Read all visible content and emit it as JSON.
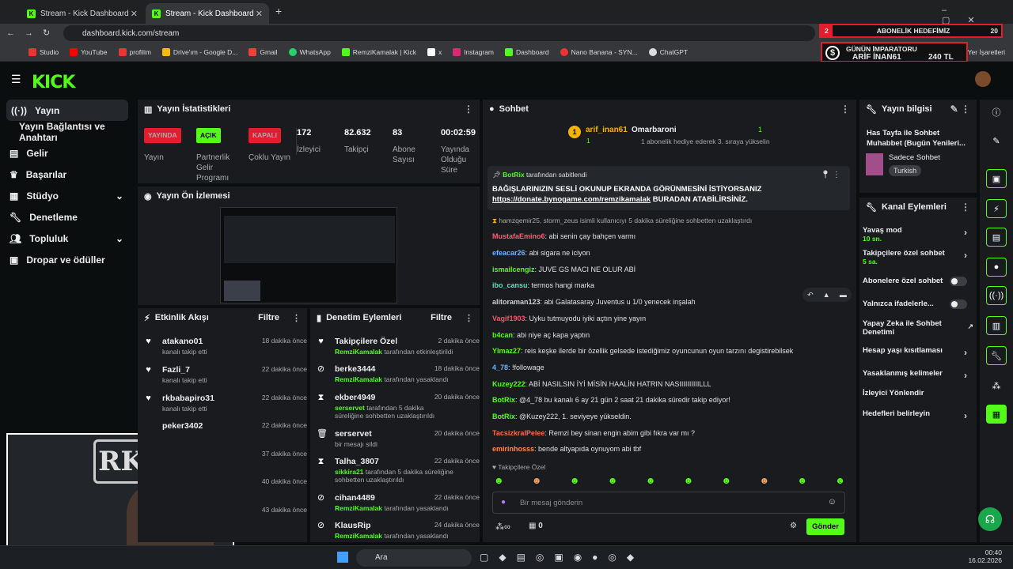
{
  "browser": {
    "tabs": [
      {
        "label": "Stream - Kick Dashboard"
      },
      {
        "label": "Stream - Kick Dashboard"
      }
    ],
    "url": "dashboard.kick.com/stream",
    "bookmarks": [
      "Studio",
      "YouTube",
      "profilim",
      "Drive'ım - Google D...",
      "Gmail",
      "WhatsApp",
      "RemziKamalak | Kick",
      "x",
      "Instagram",
      "Dashboard",
      "Nano Banana - SYN...",
      "ChatGPT"
    ],
    "bookmarks_right": "Yer İşaretleri"
  },
  "overlay": {
    "goal_num": "2",
    "goal_label": "ABONELİK HEDEFİMİZ",
    "goal_max": "20",
    "emperor_title": "GÜNÜN İMPARATORU",
    "emperor_name": "ARİF İNAN61",
    "emperor_amount": "240 TL"
  },
  "sidebar": {
    "items": [
      {
        "label": "Yayın"
      },
      {
        "label": "Yayın Bağlantısı ve Anahtarı"
      },
      {
        "label": "Gelir"
      },
      {
        "label": "Başarılar"
      },
      {
        "label": "Stüdyo"
      },
      {
        "label": "Denetleme"
      },
      {
        "label": "Topluluk"
      },
      {
        "label": "Dropar ve ödüller"
      }
    ]
  },
  "stats": {
    "title": "Yayın İstatistikleri",
    "items": [
      {
        "badge": "YAYINDA",
        "label": "Yayın",
        "color": "#e11d2e"
      },
      {
        "badge": "AÇIK",
        "label": "Partnerlik Gelir Programı",
        "color": "#53fc18"
      },
      {
        "badge": "KAPALI",
        "label": "Çoklu Yayın",
        "color": "#e11d2e"
      },
      {
        "value": "172",
        "label": "İzleyici"
      },
      {
        "value": "82.632",
        "label": "Takipçi"
      },
      {
        "value": "83",
        "label": "Abone Sayısı"
      },
      {
        "value": "00:02:59",
        "label": "Yayında Olduğu Süre"
      }
    ]
  },
  "preview": {
    "title": "Yayın Ön İzlemesi"
  },
  "activity": {
    "title": "Etkinlik Akışı",
    "filter": "Filtre",
    "items": [
      {
        "name": "atakano01",
        "sub": "kanalı takip etti",
        "time": "18 dakika önce"
      },
      {
        "name": "Fazli_7",
        "sub": "kanalı takip etti",
        "time": "22 dakika önce"
      },
      {
        "name": "rkbabapiro31",
        "sub": "kanalı takip etti",
        "time": "22 dakika önce"
      },
      {
        "name": "peker3402",
        "sub": "",
        "time": "22 dakika önce"
      },
      {
        "name": "",
        "sub": "",
        "time": "37 dakika önce"
      },
      {
        "name": "",
        "sub": "",
        "time": "40 dakika önce"
      },
      {
        "name": "",
        "sub": "",
        "time": "43 dakika önce"
      }
    ]
  },
  "moderation": {
    "title": "Denetim Eylemleri",
    "filter": "Filtre",
    "items": [
      {
        "name": "Takipçilere Özel",
        "who": "RemziKamalak",
        "sub": "tarafından etkinleştirildi",
        "time": "2 dakika önce",
        "icon": "heart"
      },
      {
        "name": "berke3444",
        "who": "RemziKamalak",
        "sub": "tarafından yasaklandı",
        "time": "18 dakika önce",
        "icon": "ban"
      },
      {
        "name": "ekber4949",
        "who": "serservet",
        "sub": "tarafından 5 dakika süreliğine sohbetten uzaklaştırıldı",
        "time": "20 dakika önce",
        "icon": "hourglass"
      },
      {
        "name": "serservet",
        "who": "",
        "sub": "bir mesajı sildi",
        "time": "20 dakika önce",
        "icon": "trash"
      },
      {
        "name": "Talha_3807",
        "who": "sikkira21",
        "sub": "tarafından 5 dakika süreliğine sohbetten uzaklaştırıldı",
        "time": "22 dakika önce",
        "icon": "hourglass"
      },
      {
        "name": "cihan4489",
        "who": "RemziKamalak",
        "sub": "tarafından yasaklandı",
        "time": "22 dakika önce",
        "icon": "ban"
      },
      {
        "name": "KlausRip",
        "who": "RemziKamalak",
        "sub": "tarafından yasaklandı",
        "time": "24 dakika önce",
        "icon": "ban"
      }
    ]
  },
  "chat": {
    "title": "Sohbet",
    "gifter_rank": "1",
    "gifter_name": "arif_inan61",
    "gifter_count": "1",
    "next_name": "Omarbaroni",
    "next_rank": "1",
    "next_sub": "1 abonelik hediye ederek 3. sıraya yükselin",
    "pinned_by": "BotRix",
    "pinned_suffix": "tarafından sabitlendi",
    "pinned_text": "BAĞIŞLARINIZIN SESLİ OKUNUP EKRANDA GÖRÜNMESİNİ İSTİYORSANIZ",
    "pinned_link": "https://donate.bynogame.com/remzikamalak",
    "pinned_link_suffix": "BURADAN ATABİLİRSİNİZ.",
    "system": "hamzqemir25, storm_zeus isimli kullanıcıyı 5 dakika süreliğine sohbetten uzaklaştırdı",
    "messages": [
      {
        "user": "MustafaEmino6",
        "text": "abi senin çay bahçen varmı",
        "color": "#ff5c7a"
      },
      {
        "user": "efeacar26",
        "text": "abi sigara ne iciyon",
        "color": "#6fb4ff"
      },
      {
        "user": "ismailcengiz",
        "text": "JUVE GS MACI NE OLUR ABİ",
        "color": "#53fc18"
      },
      {
        "user": "ibo_cansu",
        "text": "termos hangi marka",
        "color": "#4fe3c1"
      },
      {
        "user": "alitoraman123",
        "text": "abi Galatasaray Juventus u 1/0 yenecek inşalah",
        "color": "#cfcfcf"
      },
      {
        "user": "Vagif1903",
        "text": "Uyku tutmuyodu iyiki açtın yine yayın",
        "color": "#ff4f6e"
      },
      {
        "user": "b4can",
        "text": "abi niye aç kapa yaptın",
        "color": "#53fc18"
      },
      {
        "user": "Ylmaz27",
        "text": "reis keşke ilerde bir özellik gelsede istediğimiz oyuncunun oyun tarzını degistirebilsek",
        "color": "#53fc18"
      },
      {
        "user": "4_78",
        "text": "!followage",
        "color": "#6fb4ff"
      },
      {
        "user": "Kuzey222",
        "text": "ABİ NASILSIN İYİ MİSİN HAALİN HATRIN NASIIIIIIIIIILLL",
        "color": "#53fc18"
      },
      {
        "user": "BotRix",
        "text": "@4_78 bu kanalı 6 ay 21 gün 2 saat 21 dakika süredir takip ediyor!",
        "color": "#53fc18"
      },
      {
        "user": "BotRix",
        "text": "@Kuzey222, 1. seviyeye yükseldin.",
        "color": "#53fc18"
      },
      {
        "user": "TacsizkralPelee",
        "text": "Remzi bey sinan engin abim gibi fıkra var mı ?",
        "color": "#ff6a4d"
      },
      {
        "user": "emirinhosss",
        "text": "bende altyapıda oynuyom abi tbf",
        "color": "#ff8c4d"
      }
    ],
    "mode": "Takipçilere Özel",
    "placeholder": "Bir mesaj gönderin",
    "points": "0",
    "send": "Gönder"
  },
  "stream_info": {
    "title": "Yayın bilgisi",
    "stream_title": "Has Tayfa ile Sohbet Muhabbet (Bugün Yenileri...",
    "category": "Sadece Sohbet",
    "tag": "Turkish"
  },
  "channel_actions": {
    "title": "Kanal Eylemleri",
    "items": [
      {
        "label": "Yavaş mod",
        "sub": "10 sn.",
        "kind": "arrow"
      },
      {
        "label": "Takipçilere özel sohbet",
        "sub": "5 sa.",
        "kind": "arrow"
      },
      {
        "label": "Abonelere özel sohbet",
        "sub": "",
        "kind": "toggle"
      },
      {
        "label": "Yalnızca ifadelerle...",
        "sub": "",
        "kind": "toggle"
      },
      {
        "label": "Yapay Zeka ile Sohbet Denetimi",
        "sub": "",
        "kind": "ext"
      },
      {
        "label": "Hesap yaşı kısıtlaması",
        "sub": "",
        "kind": "arrow"
      },
      {
        "label": "Yasaklanmış kelimeler",
        "sub": "",
        "kind": "arrow"
      },
      {
        "label": "İzleyici Yönlendir",
        "sub": "",
        "kind": "none"
      },
      {
        "label": "Hedefleri belirleyin",
        "sub": "",
        "kind": "arrow"
      }
    ]
  },
  "taskbar": {
    "search": "Ara",
    "time": "00:40",
    "date": "16.02.2026"
  }
}
